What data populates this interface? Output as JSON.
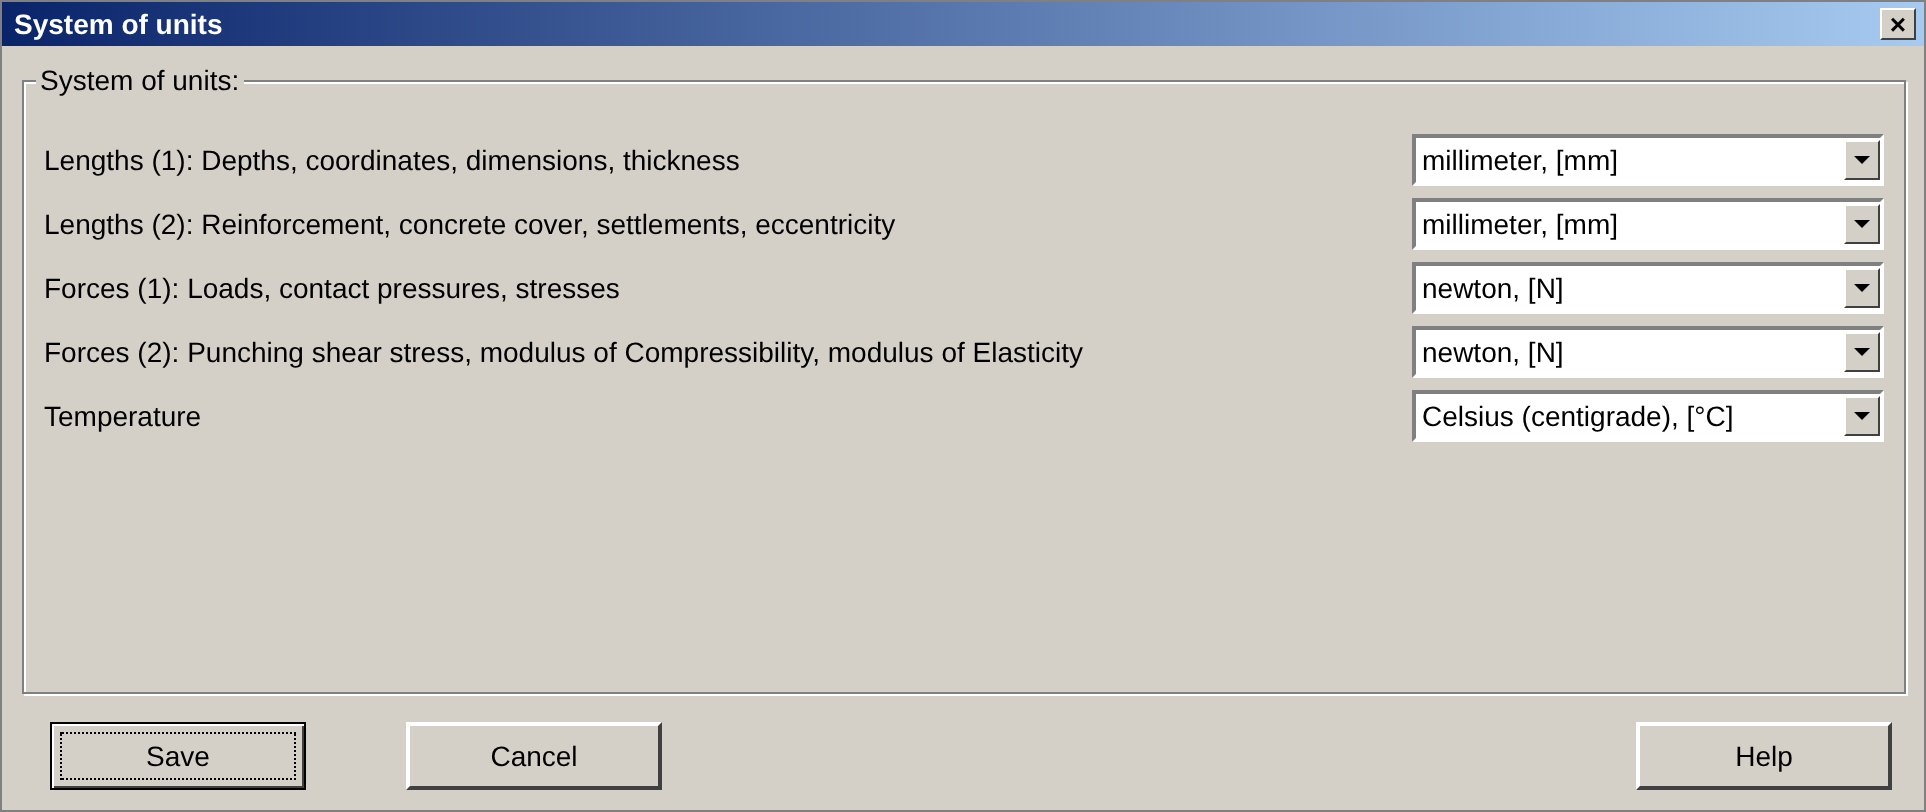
{
  "window": {
    "title": "System of units",
    "close": "×"
  },
  "group": {
    "title": "System of units:"
  },
  "rows": [
    {
      "label": "Lengths (1): Depths, coordinates, dimensions, thickness",
      "value": "millimeter, [mm]"
    },
    {
      "label": "Lengths (2): Reinforcement, concrete cover, settlements, eccentricity",
      "value": "millimeter, [mm]"
    },
    {
      "label": "Forces (1): Loads, contact pressures, stresses",
      "value": "newton, [N]"
    },
    {
      "label": "Forces (2): Punching shear stress, modulus of Compressibility, modulus of Elasticity",
      "value": "newton, [N]"
    },
    {
      "label": "Temperature",
      "value": "Celsius (centigrade), [°C]"
    }
  ],
  "buttons": [
    {
      "label": "Save",
      "focused": true
    },
    {
      "label": "Cancel",
      "focused": false
    },
    {
      "label": "Help",
      "focused": false
    }
  ]
}
